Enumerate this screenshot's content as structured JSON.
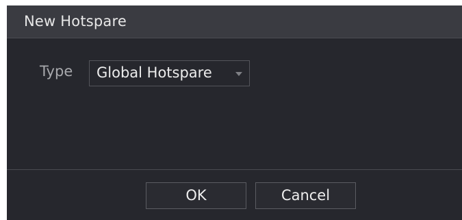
{
  "dialog": {
    "title": "New Hotspare",
    "type_label": "Type",
    "type_select": {
      "selected": "Global Hotspare"
    },
    "buttons": {
      "ok_label": "OK",
      "cancel_label": "Cancel"
    }
  },
  "colors": {
    "dialog_bg": "#26272d",
    "titlebar_bg": "#3a3b41",
    "border": "#54555b",
    "text_primary": "#ececec",
    "text_secondary": "#a8a9ad"
  }
}
